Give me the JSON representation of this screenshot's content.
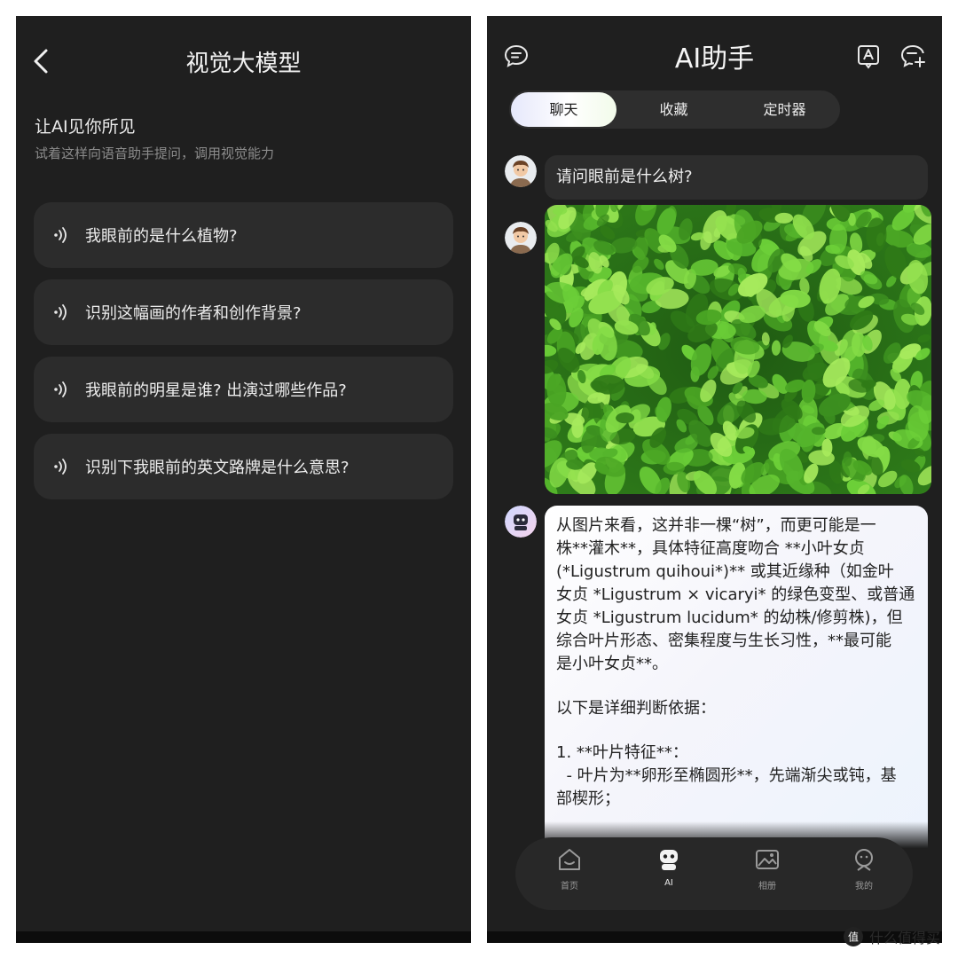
{
  "left": {
    "title": "视觉大模型",
    "intro_heading": "让AI见你所见",
    "intro_sub": "试着这样向语音助手提问，调用视觉能力",
    "prompts": [
      "我眼前的是什么植物?",
      "识别这幅画的作者和创作背景?",
      "我眼前的明星是谁? 出演过哪些作品?",
      "识别下我眼前的英文路牌是什么意思?"
    ]
  },
  "right": {
    "title": "AI助手",
    "tabs": [
      "聊天",
      "收藏",
      "定时器"
    ],
    "active_tab": "聊天",
    "user_message": "请问眼前是什么树?",
    "ai_message": {
      "lines": [
        "从图片来看，这并非一棵“树”，而更可能是一",
        "株**灌木**，具体特征高度吻合 **小叶女贞",
        "(*Ligustrum quihoui*)** 或其近缘种（如金叶",
        "女贞 *Ligustrum × vicaryi* 的绿色变型、或普通",
        "女贞 *Ligustrum lucidum* 的幼株/修剪株)，但",
        "综合叶片形态、密集程度与生长习性，**最可能",
        "是小叶女贞**。",
        "",
        "以下是详细判断依据：",
        "",
        "1. **叶片特征**：",
        "  - 叶片为**卵形至椭圆形**，先端渐尖或钝，基",
        "部楔形；"
      ]
    },
    "nav": [
      {
        "label": "首页",
        "icon": "home-icon"
      },
      {
        "label": "AI",
        "icon": "robot-icon"
      },
      {
        "label": "相册",
        "icon": "gallery-icon"
      },
      {
        "label": "我的",
        "icon": "profile-icon"
      }
    ],
    "active_nav": "AI",
    "colors": {
      "panel_bg": "#1f1f1f",
      "card_bg": "#2c2c2c",
      "leaf_green": "#4caf2a"
    }
  },
  "watermark": {
    "text": "什么值得买",
    "logo_char": "值"
  }
}
